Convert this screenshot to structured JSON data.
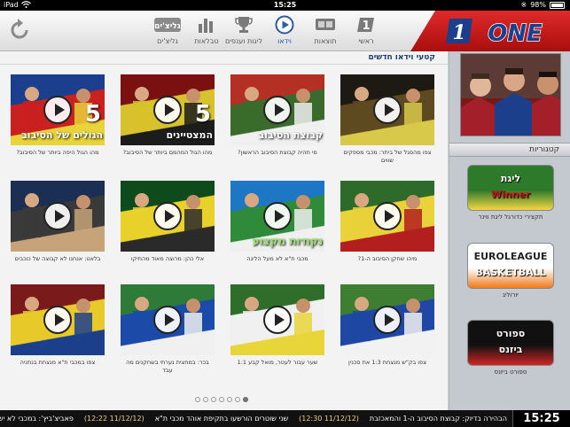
{
  "status_bar": {
    "carrier": "iPad",
    "time": "15:25",
    "battery_percent": "98%",
    "battery_level": 0.98
  },
  "toolbar": {
    "nav": [
      {
        "label": "ראשי",
        "icon": "home-one-icon"
      },
      {
        "label": "תוצאות",
        "icon": "scoreboard-icon"
      },
      {
        "label": "וידאו",
        "icon": "play-circle-icon",
        "active": true
      },
      {
        "label": "ליגות וענפים",
        "icon": "trophy-icon"
      },
      {
        "label": "טבלאות",
        "icon": "bar-chart-icon"
      },
      {
        "label": "גליצ'ים",
        "icon": "glitches-logo-icon"
      }
    ],
    "glitch_logo_text": "גליצ'ים",
    "brand_logo_text": "ONE",
    "brand_logo_number": "1"
  },
  "main": {
    "section_title": "קטעי וידאו חדשים",
    "tiles": [
      {
        "caption": "צפו מהסגל של ביתר: מכבי מספקים שווים",
        "palette": [
          "#1d1a14",
          "#5d4a20",
          "#d8c94a"
        ]
      },
      {
        "caption": "מי תהיה קבוצת הסיבוב הראשון?",
        "palette": [
          "#b43025",
          "#3a6b2c",
          "#f0f0f0"
        ],
        "overlay": "קבוצת הסיבוב"
      },
      {
        "caption": "מהו הגול המהמם ביותר של הסיבוב?",
        "palette": [
          "#7a1010",
          "#d7c22d",
          "#1c1c1c"
        ],
        "overlay": "המצטיינים",
        "number": "5"
      },
      {
        "caption": "מהו הגול היפה ביותר של הסיבוב?",
        "palette": [
          "#1b3f8c",
          "#c92020",
          "#e9d33a"
        ],
        "overlay": "הגולים של הסיבוב",
        "number": "5"
      },
      {
        "caption": "מיהו שחקן הסיבוב ה-1?",
        "palette": [
          "#2e6a2a",
          "#e9d23a",
          "#b31f1f"
        ]
      },
      {
        "caption": "מכבי ת\"א לא מעל הליגה",
        "palette": [
          "#1d77c4",
          "#2f8a3a",
          "#f0f0f0"
        ],
        "overlay": "נקודות מקצוע",
        "green": true
      },
      {
        "caption": "אלי כהן: מרוצה מאוד מהתיקו",
        "palette": [
          "#0d4a1c",
          "#e8d12a",
          "#2a2a2a"
        ]
      },
      {
        "caption": "בלאט: אנחנו לא קבוצה של כוכבים",
        "palette": [
          "#1b2f55",
          "#3a3a3a",
          "#c7a37a"
        ]
      },
      {
        "caption": "צפו בק\"ש מנצחת 1:3 את סכנין",
        "palette": [
          "#3d7e32",
          "#1e48a3",
          "#f2f2f2"
        ]
      },
      {
        "caption": "שער עבור לעטר, מואל קבע 1:1",
        "palette": [
          "#2f6e2a",
          "#f0f0f0",
          "#e8d53a"
        ]
      },
      {
        "caption": "בכר: במחצית נערתי בשחקנים מה עבד",
        "palette": [
          "#2e7a38",
          "#1b4aa8",
          "#f0f0f0"
        ]
      },
      {
        "caption": "צפו במכבי ת\"א מנצחת בנתניה",
        "palette": [
          "#7a1a1a",
          "#e8c92a",
          "#1c3f8c"
        ]
      }
    ],
    "pager": {
      "count": 7,
      "active_index": 6
    }
  },
  "sidebar": {
    "categories_header": "קטגוריות",
    "categories": [
      {
        "name": "תקצירי כדורגל ליגת ווינר",
        "logo_line1": "ליגת",
        "logo_line2": "Winner",
        "palette": [
          "#2d7a2a",
          "#f2d640"
        ]
      },
      {
        "name": "יורוליג",
        "logo_line1": "EUROLEAGUE",
        "logo_line2": "BASKETBALL",
        "palette": [
          "#ffffff",
          "#f07a1b"
        ]
      },
      {
        "name": "ספורט ביזנס",
        "logo_line1": "ספורט",
        "logo_line2": "ביזנס",
        "palette": [
          "#111111",
          "#d12424"
        ]
      }
    ]
  },
  "ticker": {
    "time": "15:25",
    "items": [
      "הבהירה בדיוק: קבוצת הסיבוב ה-1 והמאכזבת",
      "(11/12/12 12:30)",
      "שני שוטרים הורשעו בתקיפת אוהד מכבי ת\"א",
      "(11/12/12 12:22)",
      "פאביצ'ביץ': במכבי לא יש"
    ]
  }
}
